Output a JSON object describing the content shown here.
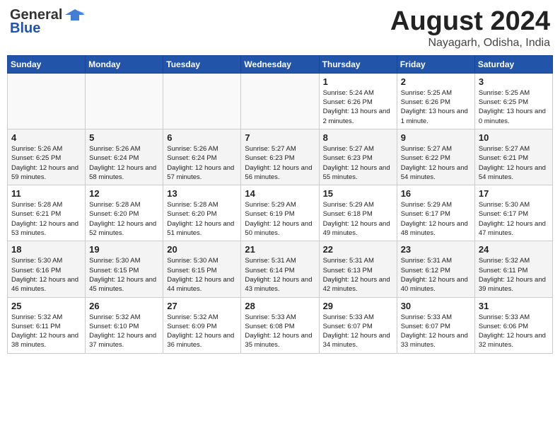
{
  "header": {
    "logo_line1": "General",
    "logo_line2": "Blue",
    "month_title": "August 2024",
    "location": "Nayagarh, Odisha, India"
  },
  "weekdays": [
    "Sunday",
    "Monday",
    "Tuesday",
    "Wednesday",
    "Thursday",
    "Friday",
    "Saturday"
  ],
  "weeks": [
    [
      {
        "day": "",
        "empty": true
      },
      {
        "day": "",
        "empty": true
      },
      {
        "day": "",
        "empty": true
      },
      {
        "day": "",
        "empty": true
      },
      {
        "day": "1",
        "sunrise": "5:24 AM",
        "sunset": "6:26 PM",
        "daylight": "13 hours and 2 minutes."
      },
      {
        "day": "2",
        "sunrise": "5:25 AM",
        "sunset": "6:26 PM",
        "daylight": "13 hours and 1 minute."
      },
      {
        "day": "3",
        "sunrise": "5:25 AM",
        "sunset": "6:25 PM",
        "daylight": "13 hours and 0 minutes."
      }
    ],
    [
      {
        "day": "4",
        "sunrise": "5:26 AM",
        "sunset": "6:25 PM",
        "daylight": "12 hours and 59 minutes."
      },
      {
        "day": "5",
        "sunrise": "5:26 AM",
        "sunset": "6:24 PM",
        "daylight": "12 hours and 58 minutes."
      },
      {
        "day": "6",
        "sunrise": "5:26 AM",
        "sunset": "6:24 PM",
        "daylight": "12 hours and 57 minutes."
      },
      {
        "day": "7",
        "sunrise": "5:27 AM",
        "sunset": "6:23 PM",
        "daylight": "12 hours and 56 minutes."
      },
      {
        "day": "8",
        "sunrise": "5:27 AM",
        "sunset": "6:23 PM",
        "daylight": "12 hours and 55 minutes."
      },
      {
        "day": "9",
        "sunrise": "5:27 AM",
        "sunset": "6:22 PM",
        "daylight": "12 hours and 54 minutes."
      },
      {
        "day": "10",
        "sunrise": "5:27 AM",
        "sunset": "6:21 PM",
        "daylight": "12 hours and 54 minutes."
      }
    ],
    [
      {
        "day": "11",
        "sunrise": "5:28 AM",
        "sunset": "6:21 PM",
        "daylight": "12 hours and 53 minutes."
      },
      {
        "day": "12",
        "sunrise": "5:28 AM",
        "sunset": "6:20 PM",
        "daylight": "12 hours and 52 minutes."
      },
      {
        "day": "13",
        "sunrise": "5:28 AM",
        "sunset": "6:20 PM",
        "daylight": "12 hours and 51 minutes."
      },
      {
        "day": "14",
        "sunrise": "5:29 AM",
        "sunset": "6:19 PM",
        "daylight": "12 hours and 50 minutes."
      },
      {
        "day": "15",
        "sunrise": "5:29 AM",
        "sunset": "6:18 PM",
        "daylight": "12 hours and 49 minutes."
      },
      {
        "day": "16",
        "sunrise": "5:29 AM",
        "sunset": "6:17 PM",
        "daylight": "12 hours and 48 minutes."
      },
      {
        "day": "17",
        "sunrise": "5:30 AM",
        "sunset": "6:17 PM",
        "daylight": "12 hours and 47 minutes."
      }
    ],
    [
      {
        "day": "18",
        "sunrise": "5:30 AM",
        "sunset": "6:16 PM",
        "daylight": "12 hours and 46 minutes."
      },
      {
        "day": "19",
        "sunrise": "5:30 AM",
        "sunset": "6:15 PM",
        "daylight": "12 hours and 45 minutes."
      },
      {
        "day": "20",
        "sunrise": "5:30 AM",
        "sunset": "6:15 PM",
        "daylight": "12 hours and 44 minutes."
      },
      {
        "day": "21",
        "sunrise": "5:31 AM",
        "sunset": "6:14 PM",
        "daylight": "12 hours and 43 minutes."
      },
      {
        "day": "22",
        "sunrise": "5:31 AM",
        "sunset": "6:13 PM",
        "daylight": "12 hours and 42 minutes."
      },
      {
        "day": "23",
        "sunrise": "5:31 AM",
        "sunset": "6:12 PM",
        "daylight": "12 hours and 40 minutes."
      },
      {
        "day": "24",
        "sunrise": "5:32 AM",
        "sunset": "6:11 PM",
        "daylight": "12 hours and 39 minutes."
      }
    ],
    [
      {
        "day": "25",
        "sunrise": "5:32 AM",
        "sunset": "6:11 PM",
        "daylight": "12 hours and 38 minutes."
      },
      {
        "day": "26",
        "sunrise": "5:32 AM",
        "sunset": "6:10 PM",
        "daylight": "12 hours and 37 minutes."
      },
      {
        "day": "27",
        "sunrise": "5:32 AM",
        "sunset": "6:09 PM",
        "daylight": "12 hours and 36 minutes."
      },
      {
        "day": "28",
        "sunrise": "5:33 AM",
        "sunset": "6:08 PM",
        "daylight": "12 hours and 35 minutes."
      },
      {
        "day": "29",
        "sunrise": "5:33 AM",
        "sunset": "6:07 PM",
        "daylight": "12 hours and 34 minutes."
      },
      {
        "day": "30",
        "sunrise": "5:33 AM",
        "sunset": "6:07 PM",
        "daylight": "12 hours and 33 minutes."
      },
      {
        "day": "31",
        "sunrise": "5:33 AM",
        "sunset": "6:06 PM",
        "daylight": "12 hours and 32 minutes."
      }
    ]
  ]
}
